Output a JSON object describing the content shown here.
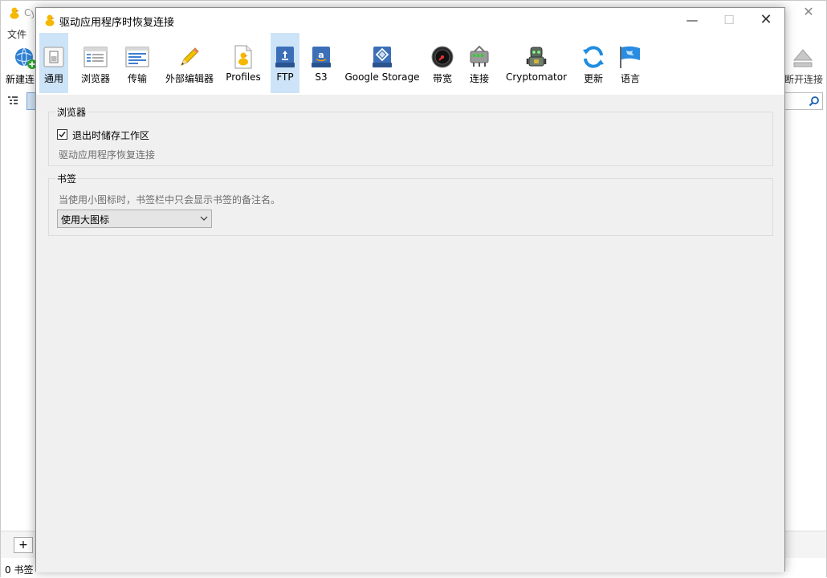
{
  "main": {
    "title": "Cy",
    "menu_file": "文件",
    "new_connection": "新建连",
    "disconnect": "断开连接",
    "status": "0 书签",
    "add_button": "+"
  },
  "dialog": {
    "title": "驱动应用程序时恢复连接",
    "minimize": "—",
    "maximize": "☐",
    "close": "✕",
    "toolbar": {
      "general": "通用",
      "browser": "浏览器",
      "transfers": "传输",
      "editor": "外部编辑器",
      "profiles": "Profiles",
      "ftp": "FTP",
      "s3": "S3",
      "google_storage": "Google Storage",
      "bandwidth": "带宽",
      "connection": "连接",
      "cryptomator": "Cryptomator",
      "update": "更新",
      "language": "语言"
    },
    "browser_group": {
      "title": "浏览器",
      "save_workspace_label": "退出时储存工作区",
      "save_workspace_checked": true,
      "hint": "驱动应用程序恢复连接"
    },
    "bookmarks_group": {
      "title": "书签",
      "hint": "当使用小图标时，书签栏中只会显示书签的备注名。",
      "icon_size_selected": "使用大图标"
    }
  },
  "colors": {
    "active_tab": "#cde3f7",
    "dialog_bg": "#f0f0f0",
    "toolbar_bg": "#ffffff"
  }
}
